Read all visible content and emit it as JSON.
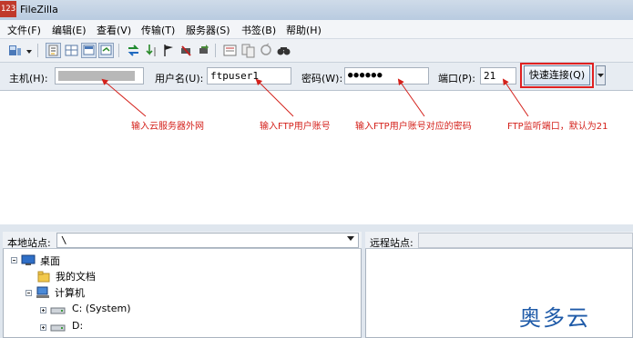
{
  "window": {
    "title": "FileZilla",
    "icon_text": "123"
  },
  "menu": {
    "items": [
      "文件(F)",
      "编辑(E)",
      "查看(V)",
      "传输(T)",
      "服务器(S)",
      "书签(B)",
      "帮助(H)"
    ]
  },
  "toolbar": {
    "icons": [
      "site-manager-icon",
      "site-manager-dropdown-icon",
      "toggle-log-icon",
      "toggle-local-tree-icon",
      "toggle-remote-tree-icon",
      "toggle-queue-icon",
      "refresh-icon",
      "process-queue-icon",
      "cancel-icon",
      "disconnect-icon",
      "reconnect-icon",
      "filter-icon",
      "compare-icon",
      "sync-browse-icon",
      "search-icon"
    ]
  },
  "quickconnect": {
    "host_label": "主机(H):",
    "host_value": "",
    "user_label": "用户名(U):",
    "user_value": "ftpuser1",
    "pass_label": "密码(W):",
    "pass_value": "●●●●●●",
    "port_label": "端口(P):",
    "port_value": "21",
    "button_label": "快速连接(Q)"
  },
  "annotations": {
    "host": "输入云服务器外网",
    "user": "输入FTP用户账号",
    "pass": "输入FTP用户账号对应的密码",
    "port": "FTP监听端口，默认为21"
  },
  "accent_color": "#d4211b",
  "local": {
    "label": "本地站点:",
    "path": "\\",
    "tree": [
      "桌面",
      "我的文档",
      "计算机",
      "C: (System)",
      "D:"
    ]
  },
  "remote": {
    "label": "远程站点:",
    "path": ""
  },
  "watermark": "奥多云"
}
